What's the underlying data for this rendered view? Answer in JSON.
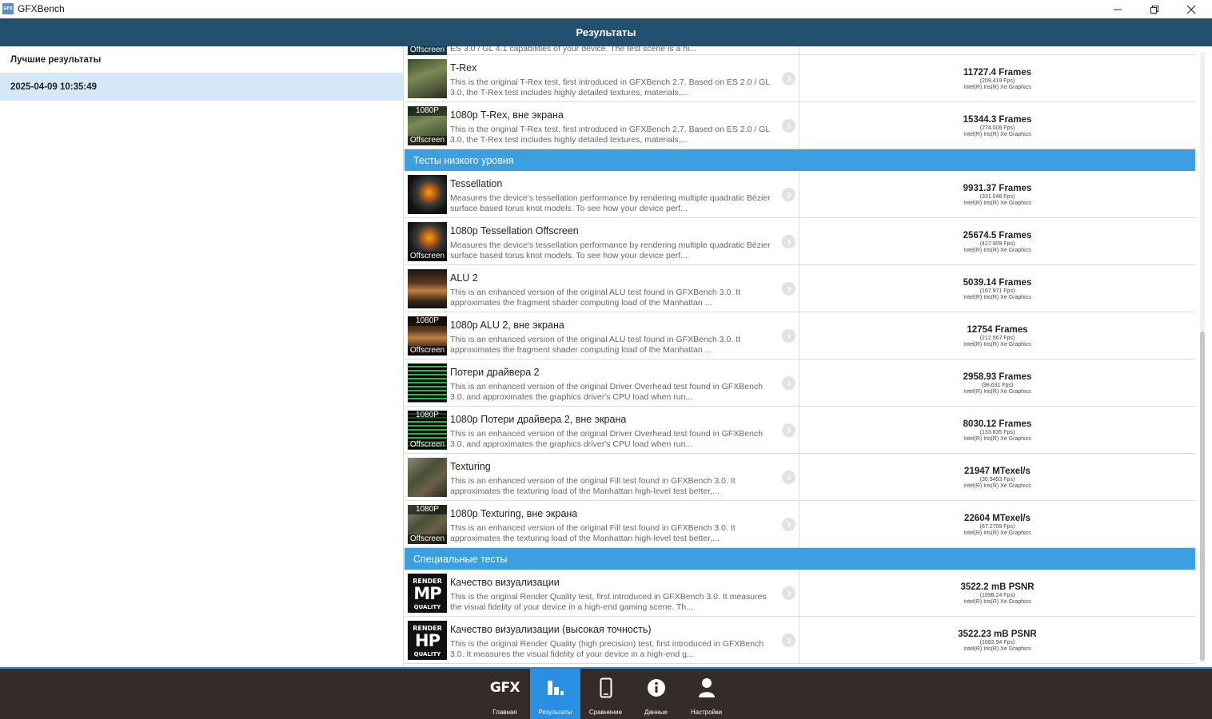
{
  "window": {
    "icon_text": "GFX",
    "title": "GFXBench"
  },
  "header": {
    "title": "Результаты"
  },
  "left_panel": {
    "items": [
      {
        "label": "Лучшие результаты"
      },
      {
        "label": "2025-04-09 10:35:49"
      }
    ]
  },
  "partial_row": {
    "badge": "Offscreen",
    "desc": "ES 3.0 / GL 4.1 capabilities of your device. The test scene is a hi..."
  },
  "rows_top": [
    {
      "name": "T-Rex",
      "desc": "This is the original T-Rex test, first introduced in GFXBench 2.7. Based on ES 2.0 / GL 3.0, the T-Rex test includes highly detailed textures, materials,...",
      "score": "11727.4 Frames",
      "fps": "(209.419 Fps)",
      "gpu": "Intel(R) Iris(R) Xe Graphics",
      "badge_top": "",
      "badge_bottom": ""
    },
    {
      "name": "1080p T-Rex, вне экрана",
      "desc": "This is the original T-Rex test, first introduced in GFXBench 2.7. Based on ES 2.0 / GL 3.0, the T-Rex test includes highly detailed textures, materials,...",
      "score": "15344.3 Frames",
      "fps": "(274.006 Fps)",
      "gpu": "Intel(R) Iris(R) Xe Graphics",
      "badge_top": "1080P",
      "badge_bottom": "Offscreen"
    }
  ],
  "section_low": {
    "title": "Тесты низкого уровня"
  },
  "rows_low": [
    {
      "name": "Tessellation",
      "desc": "Measures the device's tessellation performance by rendering multiple quadratic Bézier surface based torus knot models. To see how your device perf...",
      "score": "9931.37 Frames",
      "fps": "(331.046 Fps)",
      "gpu": "Intel(R) Iris(R) Xe Graphics",
      "badge_top": "",
      "badge_bottom": ""
    },
    {
      "name": "1080p Tessellation Offscreen",
      "desc": "Measures the device's tessellation performance by rendering multiple quadratic Bézier surface based torus knot models. To see how your device perf...",
      "score": "25674.5 Frames",
      "fps": "(427.909 Fps)",
      "gpu": "Intel(R) Iris(R) Xe Graphics",
      "badge_top": "",
      "badge_bottom": "Offscreen"
    },
    {
      "name": "ALU 2",
      "desc": "This is an enhanced version of the original ALU test found in GFXBench 3.0. It approximates the fragment shader computing load of the Manhattan ...",
      "score": "5039.14 Frames",
      "fps": "(167.971 Fps)",
      "gpu": "Intel(R) Iris(R) Xe Graphics",
      "badge_top": "",
      "badge_bottom": ""
    },
    {
      "name": "1080p ALU 2, вне экрана",
      "desc": "This is an enhanced version of the original ALU test found in GFXBench 3.0. It approximates the fragment shader computing load of the Manhattan ...",
      "score": "12754 Frames",
      "fps": "(212.567 Fps)",
      "gpu": "Intel(R) Iris(R) Xe Graphics",
      "badge_top": "1080P",
      "badge_bottom": "Offscreen"
    },
    {
      "name": "Потери драйвера 2",
      "desc": "This is an enhanced version of the original Driver Overhead test found in GFXBench 3.0, and approximates the graphics driver's CPU load when run...",
      "score": "2958.93 Frames",
      "fps": "(98.631 Fps)",
      "gpu": "Intel(R) Iris(R) Xe Graphics",
      "badge_top": "",
      "badge_bottom": ""
    },
    {
      "name": "1080p Потери драйвера 2, вне экрана",
      "desc": "This is an enhanced version of the original Driver Overhead test found in GFXBench 3.0, and approximates the graphics driver's CPU load when run...",
      "score": "8030.12 Frames",
      "fps": "(133.835 Fps)",
      "gpu": "Intel(R) Iris(R) Xe Graphics",
      "badge_top": "1080P",
      "badge_bottom": "Offscreen"
    },
    {
      "name": "Texturing",
      "desc": "This is an enhanced version of the original Fill test found in GFXBench 3.0. It approximates the texturing load of the Manhattan high-level test better,...",
      "score": "21947 MTexel/s",
      "fps": "(30.9453 Fps)",
      "gpu": "Intel(R) Iris(R) Xe Graphics",
      "badge_top": "",
      "badge_bottom": ""
    },
    {
      "name": "1080p Texturing, вне экрана",
      "desc": "This is an enhanced version of the original Fill test found in GFXBench 3.0. It approximates the texturing load of the Manhattan high-level test better,...",
      "score": "22604 MTexel/s",
      "fps": "(67.2709 Fps)",
      "gpu": "Intel(R) Iris(R) Xe Graphics",
      "badge_top": "1080P",
      "badge_bottom": "Offscreen"
    }
  ],
  "section_special": {
    "title": "Специальные тесты"
  },
  "rows_special": [
    {
      "name": "Качество визуализации",
      "desc": "This is the original Render Quality test, first introduced in GFXBench 3.0. It measures the visual fidelity of your device in a high-end gaming scene. Th...",
      "score": "3522.2 mB PSNR",
      "fps": "(1098.24 Fps)",
      "gpu": "Intel(R) Iris(R) Xe Graphics",
      "icon_top": "RENDER",
      "icon_mid": "MP",
      "icon_bottom": "QUALITY"
    },
    {
      "name": "Качество визуализации (высокая точность)",
      "desc": "This is the original Render Quality (high precision) test, first introduced in GFXBench 3.0. It measures the visual fidelity of your device in a high-end g...",
      "score": "3522.23 mB PSNR",
      "fps": "(1082.94 Fps)",
      "gpu": "Intel(R) Iris(R) Xe Graphics",
      "icon_top": "RENDER",
      "icon_mid": "HP",
      "icon_bottom": "QUALITY"
    }
  ],
  "nav": {
    "home": {
      "logo": "GFX",
      "label": "Главная"
    },
    "results": {
      "label": "Результаты"
    },
    "compare": {
      "label": "Сравнение"
    },
    "info": {
      "label": "Данные"
    },
    "settings": {
      "label": "Настройки"
    }
  },
  "colors": {
    "header_bg": "#24506f",
    "section_bg": "#3b9fe0",
    "selected_bg": "#d5e8f8",
    "nav_bg": "#342c29",
    "nav_active": "#2a8fe0"
  }
}
